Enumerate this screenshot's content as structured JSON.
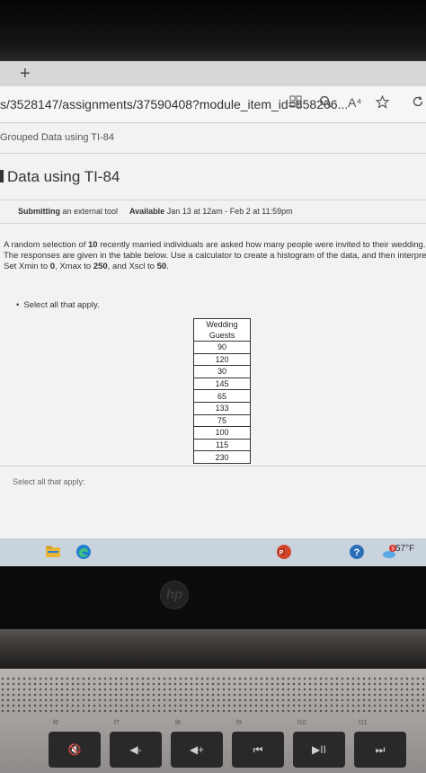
{
  "browser": {
    "newtab_glyph": "+",
    "url": "s/3528147/assignments/37590408?module_item_id=858206...",
    "toolbar_icons": [
      "tab-grid-icon",
      "zoom-icon",
      "read-aloud-icon",
      "favorite-star-icon",
      "refresh-icon"
    ],
    "read_aloud_label": "A⁴"
  },
  "page": {
    "breadcrumb": "Grouped Data using TI-84",
    "title": "Data using TI-84",
    "submitting_label": "Submitting",
    "submitting_value": "an external tool",
    "available_label": "Available",
    "available_value": "Jan 13 at 12am - Feb 2 at 11:59pm",
    "question": {
      "line1_a": "A random selection of ",
      "line1_n": "10",
      "line1_b": " recently married individuals are asked how many people were invited to their wedding.",
      "line2": "The responses are given in the table below. Use a calculator to create a histogram of the data, and then interpret the plo",
      "line3_a": "Set Xmin to ",
      "xmin": "0",
      "line3_b": ", Xmax to ",
      "xmax": "250",
      "line3_c": ", and Xscl to ",
      "xscl": "50",
      "line3_d": "."
    },
    "instruction": "Select all that apply.",
    "table": {
      "header": "Wedding Guests",
      "values": [
        "90",
        "120",
        "30",
        "145",
        "65",
        "133",
        "75",
        "100",
        "115",
        "230"
      ]
    },
    "answer_prompt": "Select all that apply:"
  },
  "taskbar": {
    "icons": [
      "file-explorer-icon",
      "edge-browser-icon",
      "powerpoint-icon",
      "help-icon",
      "weather-icon"
    ],
    "weather_badge": "9",
    "temperature": "57°F"
  },
  "laptop": {
    "logo": "hp",
    "keys": [
      {
        "fn": "f6",
        "glyph": "🔇"
      },
      {
        "fn": "f7",
        "glyph": "◀-"
      },
      {
        "fn": "f8",
        "glyph": "◀+"
      },
      {
        "fn": "f9",
        "glyph": "⏮"
      },
      {
        "fn": "f10",
        "glyph": "▶II"
      },
      {
        "fn": "f11",
        "glyph": "⏭"
      }
    ]
  },
  "colors": {
    "edge_blue": "#1f7fd0",
    "explorer_yellow": "#e8b53b",
    "powerpoint_red": "#d3452b"
  }
}
